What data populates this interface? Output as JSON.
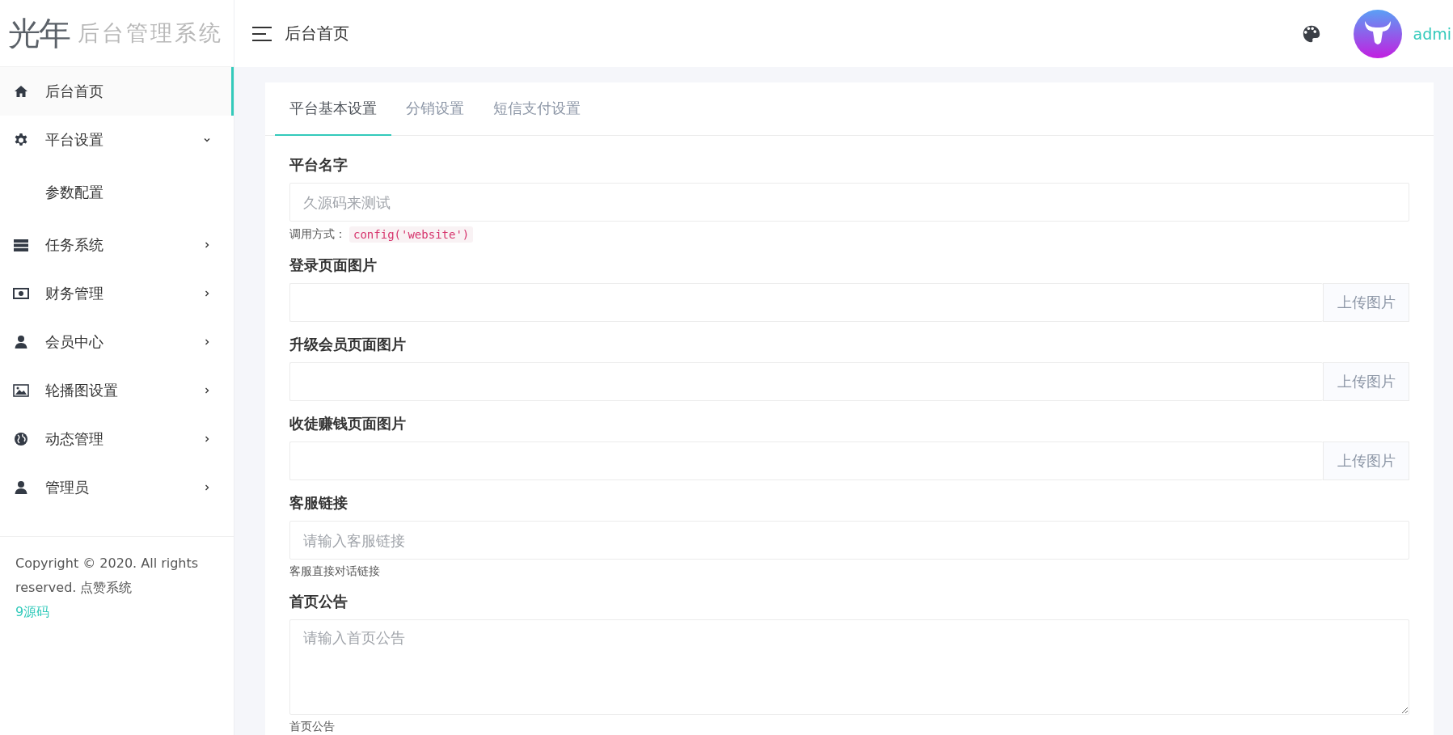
{
  "logo": {
    "mark": "光年",
    "name": "后台管理系统"
  },
  "header": {
    "title": "后台首页",
    "user": "admi"
  },
  "sidebar": {
    "items": [
      {
        "label": "后台首页",
        "selected": true
      },
      {
        "label": "平台设置",
        "selected": false,
        "expanded": true,
        "children": [
          {
            "label": "参数配置",
            "selected": false
          }
        ]
      },
      {
        "label": "任务系统",
        "selected": false,
        "expanded": false
      },
      {
        "label": "财务管理",
        "selected": false,
        "expanded": false
      },
      {
        "label": "会员中心",
        "selected": false,
        "expanded": false
      },
      {
        "label": "轮播图设置",
        "selected": false,
        "expanded": false
      },
      {
        "label": "动态管理",
        "selected": false,
        "expanded": false
      },
      {
        "label": "管理员",
        "selected": false,
        "expanded": false
      }
    ],
    "footer": {
      "text": "Copyright © 2020. All rights reserved. 点赞系统",
      "link": "9源码"
    }
  },
  "tabs": [
    {
      "label": "平台基本设置",
      "selected": true
    },
    {
      "label": "分销设置",
      "selected": false
    },
    {
      "label": "短信支付设置",
      "selected": false
    }
  ],
  "fields": [
    {
      "kind": "text",
      "label": "平台名字",
      "placeholder": "久源码来测试",
      "hint": "调用方式：",
      "hint_code": "config('website')"
    },
    {
      "kind": "upload",
      "label": "登录页面图片",
      "button": "上传图片"
    },
    {
      "kind": "upload",
      "label": "升级会员页面图片",
      "button": "上传图片"
    },
    {
      "kind": "upload",
      "label": "收徒赚钱页面图片",
      "button": "上传图片"
    },
    {
      "kind": "text",
      "label": "客服链接",
      "placeholder": "请输入客服链接",
      "hint": "客服直接对话链接"
    },
    {
      "kind": "textarea",
      "label": "首页公告",
      "placeholder": "请输入首页公告",
      "hint": "首页公告"
    }
  ]
}
